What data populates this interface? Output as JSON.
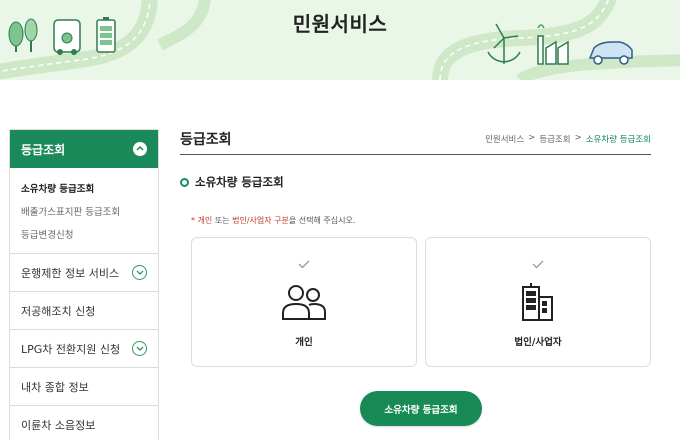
{
  "banner": {
    "title": "민원서비스"
  },
  "sidebar": {
    "active": {
      "label": "등급조회",
      "sub": [
        "소유차량 등급조회",
        "배출가스표지판 등급조회",
        "등급변경신청"
      ]
    },
    "items": [
      {
        "label": "운행제한 정보 서비스"
      },
      {
        "label": "저공해조치 신청"
      },
      {
        "label": "LPG차 전환지원 신청"
      },
      {
        "label": "내차 종합 정보"
      },
      {
        "label": "이륜차 소음정보"
      }
    ]
  },
  "main": {
    "title": "등급조회",
    "breadcrumb": [
      "민원서비스",
      ">",
      "등급조회",
      ">",
      "소유차량 등급조회"
    ],
    "section_title": "소유차량 등급조회",
    "notice": {
      "star": "*",
      "opt1": "개인",
      "mid": "또는",
      "opt2": "법인/사업자 구분",
      "tail": "을 선택해 주십시오."
    },
    "cards": [
      {
        "label": "개인",
        "icon": "people-icon"
      },
      {
        "label": "법인/사업자",
        "icon": "building-icon"
      }
    ],
    "submit_label": "소유차량 등급조회"
  },
  "colors": {
    "brand": "#1a8a5a",
    "banner_bg": "#eaf6e8",
    "accent_red": "#c0392b"
  }
}
